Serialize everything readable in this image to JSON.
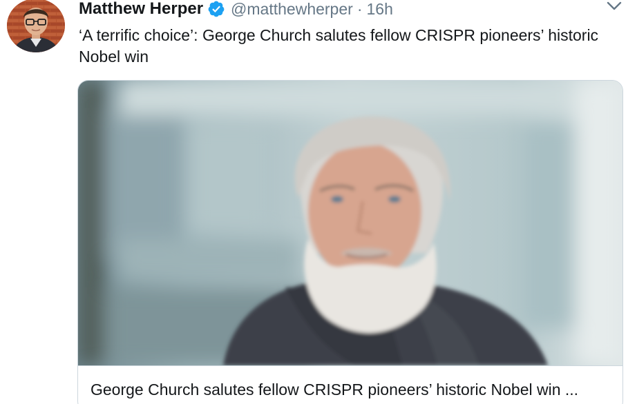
{
  "tweet": {
    "author_name": "Matthew Herper",
    "handle": "@matthewherper",
    "separator": "·",
    "timestamp": "16h",
    "text": "‘A terrific choice’: George Church salutes fellow CRISPR pioneers’ historic Nobel win"
  },
  "card": {
    "title": "George Church salutes fellow CRISPR pioneers’ historic Nobel win ..."
  },
  "icons": {
    "verified": "verified-badge-icon",
    "more": "chevron-down-icon"
  },
  "colors": {
    "verified_blue": "#1da1f2",
    "secondary_text": "#657786",
    "border": "#ccd6dd"
  }
}
